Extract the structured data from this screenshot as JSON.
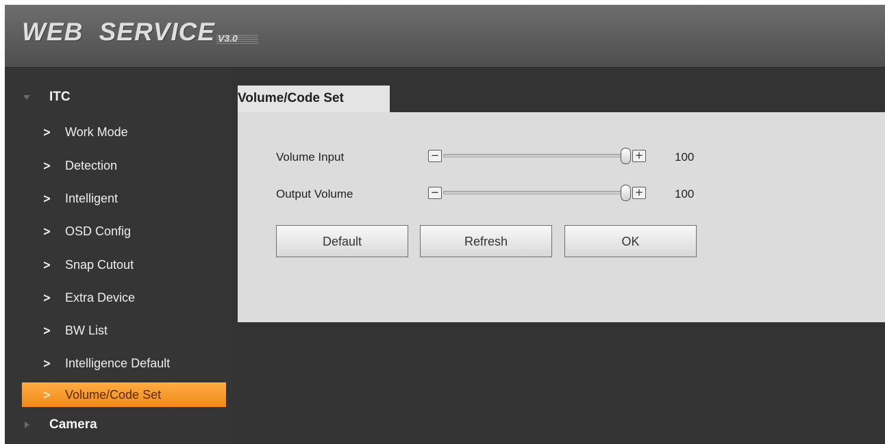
{
  "header": {
    "logo_main": "WEB SERVICE",
    "logo_version": "V3.0"
  },
  "sidebar": {
    "groups": [
      {
        "label": "ITC",
        "expanded": true,
        "icon": "triangle-down-icon"
      },
      {
        "label": "Camera",
        "expanded": false,
        "icon": "triangle-right-icon"
      }
    ],
    "items": [
      {
        "label": "Work Mode"
      },
      {
        "label": "Detection"
      },
      {
        "label": "Intelligent"
      },
      {
        "label": "OSD Config"
      },
      {
        "label": "Snap Cutout"
      },
      {
        "label": "Extra Device"
      },
      {
        "label": "BW List"
      },
      {
        "label": "Intelligence Default"
      },
      {
        "label": "Volume/Code Set",
        "active": true
      }
    ],
    "chevron": ">"
  },
  "main": {
    "tab_title": "Volume/Code Set",
    "rows": [
      {
        "label": "Volume Input",
        "value": "100",
        "level": 100
      },
      {
        "label": "Output Volume",
        "value": "100",
        "level": 100
      }
    ],
    "minus": "−",
    "plus": "+",
    "buttons": {
      "default": "Default",
      "refresh": "Refresh",
      "ok": "OK"
    }
  },
  "colors": {
    "accent": "#f5961f",
    "panel": "#dcdcdc",
    "background": "#333333"
  }
}
